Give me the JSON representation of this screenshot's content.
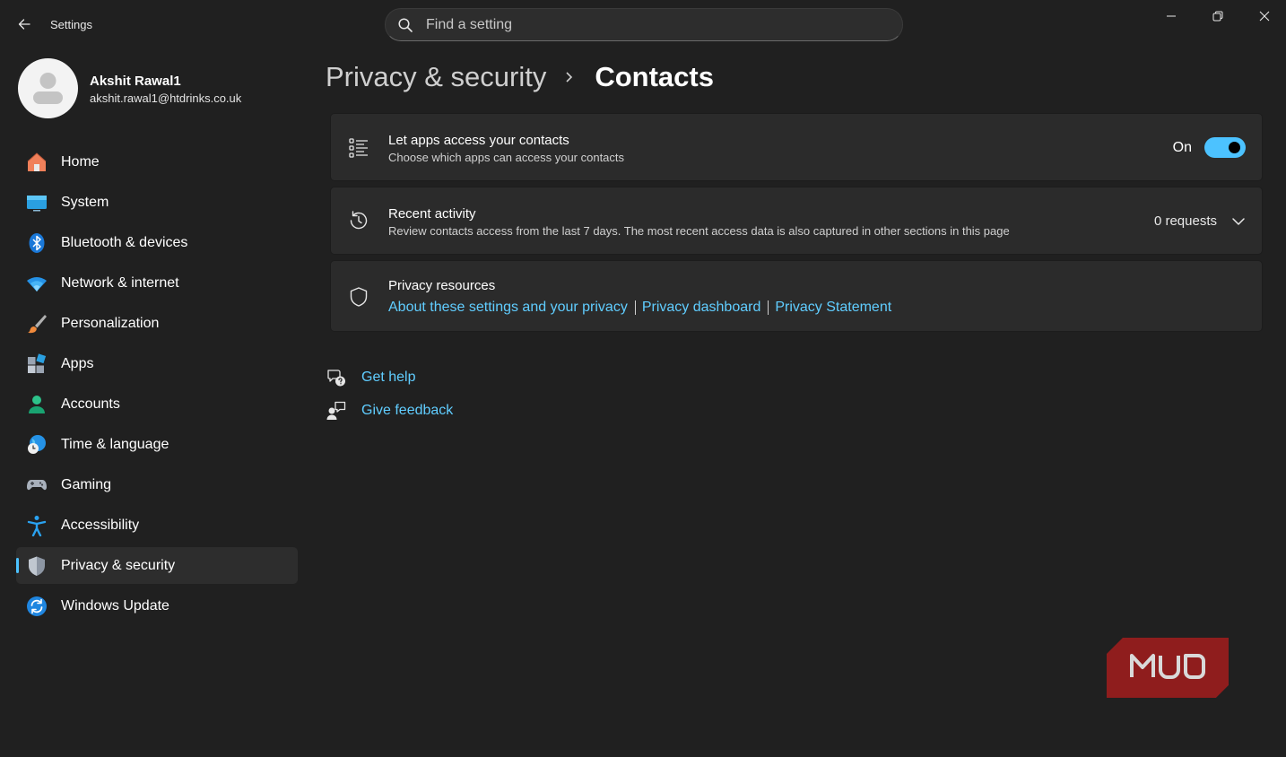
{
  "titlebar": {
    "app_title": "Settings",
    "search_placeholder": "Find a setting"
  },
  "profile": {
    "name": "Akshit Rawal1",
    "email": "akshit.rawal1@htdrinks.co.uk"
  },
  "sidebar": {
    "items": [
      {
        "label": "Home",
        "icon": "home-icon"
      },
      {
        "label": "System",
        "icon": "system-icon"
      },
      {
        "label": "Bluetooth & devices",
        "icon": "bluetooth-icon"
      },
      {
        "label": "Network & internet",
        "icon": "wifi-icon"
      },
      {
        "label": "Personalization",
        "icon": "brush-icon"
      },
      {
        "label": "Apps",
        "icon": "apps-icon"
      },
      {
        "label": "Accounts",
        "icon": "accounts-icon"
      },
      {
        "label": "Time & language",
        "icon": "globe-clock-icon"
      },
      {
        "label": "Gaming",
        "icon": "gamepad-icon"
      },
      {
        "label": "Accessibility",
        "icon": "accessibility-icon"
      },
      {
        "label": "Privacy & security",
        "icon": "shield-icon",
        "active": true
      },
      {
        "label": "Windows Update",
        "icon": "update-icon"
      }
    ]
  },
  "breadcrumb": {
    "parent": "Privacy & security",
    "current": "Contacts"
  },
  "cards": {
    "access": {
      "title": "Let apps access your contacts",
      "description": "Choose which apps can access your contacts",
      "toggle_state": "On",
      "toggle_on": true
    },
    "recent": {
      "title": "Recent activity",
      "description": "Review contacts access from the last 7 days. The most recent access data is also captured in other sections in this page",
      "requests": "0 requests"
    },
    "resources": {
      "title": "Privacy resources",
      "links": [
        "About these settings and your privacy",
        "Privacy dashboard",
        "Privacy Statement"
      ]
    }
  },
  "help": {
    "get_help": "Get help",
    "give_feedback": "Give feedback"
  },
  "colors": {
    "accent": "#4cc2ff",
    "link": "#60cdff",
    "background": "#202020",
    "card": "#2b2b2b"
  }
}
